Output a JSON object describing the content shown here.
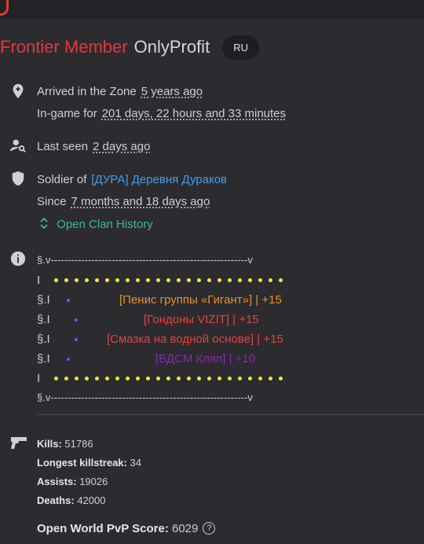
{
  "header": {
    "rank": "Frontier Member",
    "player_name": "OnlyProfit",
    "language_badge": "RU"
  },
  "profile": {
    "arrived_label": "Arrived in the Zone",
    "arrived_value": "5 years ago",
    "ingame_label": "In-game for",
    "ingame_value": "201 days, 22 hours and 33 minutes",
    "last_seen_label": "Last seen",
    "last_seen_value": "2 days ago",
    "soldier_label": "Soldier of",
    "clan_name": "[ДУРА] Деревня Дураков",
    "since_label": "Since",
    "since_value": "7 months and 18 days ago",
    "clan_history_link": "Open Clan History"
  },
  "bio": {
    "separator": "§.v----------------------------------------------------------v",
    "dots_line_prefix": "I",
    "items": [
      {
        "prefix": "§.I",
        "text": "[Пенис группы «Гигант»] | +15",
        "color": "#e8941f"
      },
      {
        "prefix": "§.I",
        "text": "[Гондоны VIZIT] | +15",
        "color": "#e4443c"
      },
      {
        "prefix": "§.I",
        "text": "[Смазка на водной основе] | +15",
        "color": "#e4443c"
      },
      {
        "prefix": "§.I",
        "text": "[БДСМ Кляп] | +10",
        "color": "#8a2aa8"
      }
    ]
  },
  "stats": {
    "kills_label": "Kills:",
    "kills": "51786",
    "killstreak_label": "Longest killstreak:",
    "killstreak": "34",
    "assists_label": "Assists:",
    "assists": "19026",
    "deaths_label": "Deaths:",
    "deaths": "42000",
    "pvp_label": "Open World PvP Score:",
    "pvp_score": "6029"
  },
  "colors": {
    "rank": "#e3393c",
    "link": "#4a9be8",
    "clan_history": "#3fb89a",
    "dots": "#f2e83b"
  },
  "icons": [
    "location-pin-icon",
    "person-search-icon",
    "shield-icon",
    "chevron-up-down-icon",
    "info-icon",
    "pistol-icon",
    "help-circle-icon"
  ]
}
